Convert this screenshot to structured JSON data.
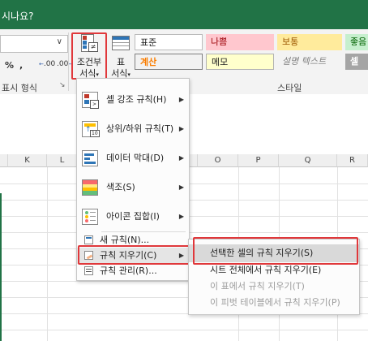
{
  "titlebar": {
    "text": "시나요?"
  },
  "ribbon": {
    "number_format_label": "표시 형식",
    "percent": "%",
    "comma": ",",
    "inc_decimal": ".00",
    "dec_decimal": ".00",
    "cond_format_label_line1": "조건부",
    "cond_format_label_line2": "서식",
    "table_label_line1": "표",
    "table_label_line2": "서식",
    "styles_label": "스타일",
    "styles": [
      {
        "label": "표준",
        "bg": "#ffffff",
        "fg": "#222222"
      },
      {
        "label": "나쁨",
        "bg": "#ffc7ce",
        "fg": "#9c0006"
      },
      {
        "label": "보통",
        "bg": "#ffeb9c",
        "fg": "#9c5700"
      },
      {
        "label": "좋음",
        "bg": "#c6efce",
        "fg": "#006100"
      },
      {
        "label": "계산",
        "bg": "#f2f2f2",
        "fg": "#fa7d00"
      },
      {
        "label": "메모",
        "bg": "#ffffcc",
        "fg": "#222222"
      },
      {
        "label": "설명 텍스트",
        "bg": "#f3f3f3",
        "fg": "#7f7f7f"
      },
      {
        "label": "셀 확",
        "bg": "#a5a5a5",
        "fg": "#ffffff"
      }
    ]
  },
  "columns": [
    "K",
    "L",
    "O",
    "P",
    "Q",
    "R"
  ],
  "menu": {
    "items": [
      {
        "label": "셀 강조 규칙(H)",
        "icon": "highlight-rules-icon"
      },
      {
        "label": "상위/하위 규칙(T)",
        "icon": "top-bottom-icon"
      },
      {
        "label": "데이터 막대(D)",
        "icon": "data-bars-icon"
      },
      {
        "label": "색조(S)",
        "icon": "color-scales-icon"
      },
      {
        "label": "아이콘 집합(I)",
        "icon": "icon-sets-icon"
      }
    ],
    "new_rule": "새 규칙(N)...",
    "clear_rules": "규칙 지우기(C)",
    "manage_rules": "규칙 관리(R)..."
  },
  "submenu": {
    "items": [
      {
        "label": "선택한 셀의 규칙 지우기(S)",
        "enabled": true
      },
      {
        "label": "시트 전체에서 규칙 지우기(E)",
        "enabled": true
      },
      {
        "label": "이 표에서 규칙 지우기(T)",
        "enabled": false
      },
      {
        "label": "이 피벗 테이블에서 규칙 지우기(P)",
        "enabled": false
      }
    ]
  },
  "colors": {
    "accent": "#217346",
    "highlight_box": "#e0383b"
  }
}
